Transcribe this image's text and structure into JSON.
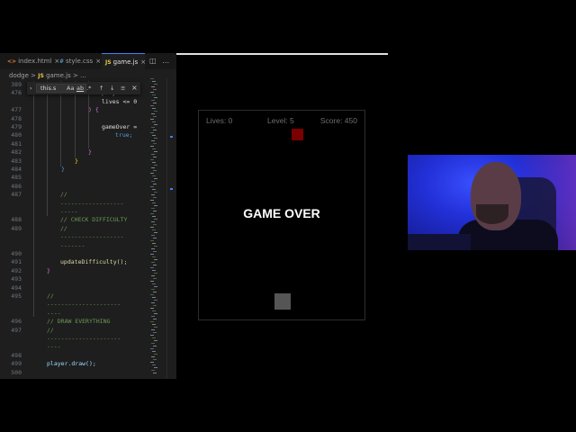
{
  "editor": {
    "tabs": [
      {
        "label": "index.html",
        "icon_text": "<>",
        "icon_color": "#e37933",
        "active": false
      },
      {
        "label": "style.css",
        "icon_text": "#",
        "icon_color": "#519aba",
        "active": false
      },
      {
        "label": "game.js",
        "icon_text": "JS",
        "icon_color": "#e6c84a",
        "active": true
      }
    ],
    "close_glyph": "×",
    "more_glyph": "…",
    "breadcrumb": {
      "folder": "dodge",
      "sep": ">",
      "file_icon": "JS",
      "file": "game.js",
      "ellipsis": "..."
    },
    "find": {
      "value": "this.s",
      "toggle_chevron": "›",
      "match_case": "Aa",
      "whole_word": "ab",
      "regex": ".*",
      "prev": "↑",
      "next": "↓",
      "select_lines": "≡",
      "close": "×"
    },
    "lines": [
      {
        "n": "389",
        "text": ""
      },
      {
        "n": "476",
        "text": "player.",
        "color": "#dcdcaa"
      },
      {
        "n": "",
        "text": "lives <= 0",
        "color": "#ddd"
      },
      {
        "n": "477",
        "text": ") {",
        "color": "#da70d6"
      },
      {
        "n": "478",
        "text": ""
      },
      {
        "n": "479",
        "text": "gameOver =",
        "color": "#ddd"
      },
      {
        "n": "480",
        "text": "true;",
        "color": "#569cd6"
      },
      {
        "n": "481",
        "text": ""
      },
      {
        "n": "482",
        "text": "}",
        "color": "#da70d6"
      },
      {
        "n": "483",
        "text": "}",
        "color": "#ffd700"
      },
      {
        "n": "484",
        "text": "}",
        "color": "#569cd6"
      },
      {
        "n": "485",
        "text": ""
      },
      {
        "n": "486",
        "text": ""
      },
      {
        "n": "487",
        "text": "//",
        "color": "#6a9955"
      },
      {
        "n": "",
        "text": "------------------",
        "color": "#6a9955"
      },
      {
        "n": "",
        "text": "-----",
        "color": "#6a9955"
      },
      {
        "n": "488",
        "text": "// CHECK DIFFICULTY",
        "color": "#6a9955"
      },
      {
        "n": "489",
        "text": "//",
        "color": "#6a9955"
      },
      {
        "n": "",
        "text": "------------------",
        "color": "#6a9955"
      },
      {
        "n": "",
        "text": "-------",
        "color": "#6a9955"
      },
      {
        "n": "490",
        "text": ""
      },
      {
        "n": "491",
        "text": "updateDifficulty();",
        "color": "#dcdcaa"
      },
      {
        "n": "492",
        "text": "}",
        "color": "#da70d6"
      },
      {
        "n": "493",
        "text": ""
      },
      {
        "n": "494",
        "text": ""
      },
      {
        "n": "495",
        "text": "//",
        "color": "#6a9955"
      },
      {
        "n": "",
        "text": "---------------------",
        "color": "#6a9955"
      },
      {
        "n": "",
        "text": "----",
        "color": "#6a9955"
      },
      {
        "n": "496",
        "text": "// DRAW EVERYTHING",
        "color": "#6a9955"
      },
      {
        "n": "497",
        "text": "//",
        "color": "#6a9955"
      },
      {
        "n": "",
        "text": "---------------------",
        "color": "#6a9955"
      },
      {
        "n": "",
        "text": "----",
        "color": "#6a9955"
      },
      {
        "n": "498",
        "text": ""
      },
      {
        "n": "499",
        "text": "player.draw();",
        "color": "#9cdcfe"
      },
      {
        "n": "500",
        "text": ""
      }
    ]
  },
  "game": {
    "lives_label": "Lives: 0",
    "level_label": "Level: 5",
    "score_label": "Score: 450",
    "game_over_text": "GAME OVER",
    "enemy_color": "#7a0000",
    "player_color": "#555555"
  },
  "colors": {
    "editor_bg": "#1e1e1e",
    "accent_tab": "#3b82f6",
    "webcam_bg": "#2230d8"
  }
}
